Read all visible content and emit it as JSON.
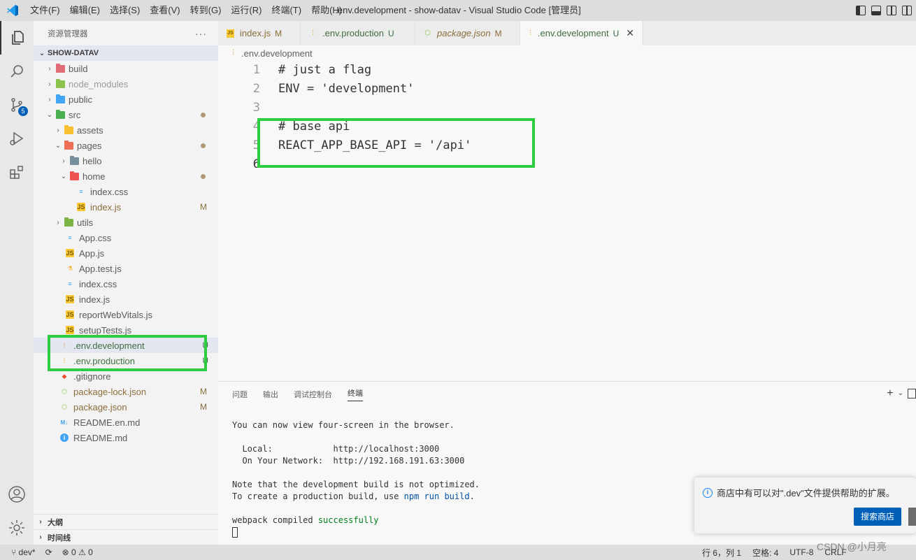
{
  "titlebar": {
    "menu": [
      "文件(F)",
      "编辑(E)",
      "选择(S)",
      "查看(V)",
      "转到(G)",
      "运行(R)",
      "终端(T)",
      "帮助(H)"
    ],
    "window_title": ".env.development - show-datav - Visual Studio Code [管理员]"
  },
  "activity": {
    "scm_badge": "5"
  },
  "sidebar": {
    "title": "资源管理器",
    "more": "···",
    "project": "SHOW-DATAV",
    "tree": {
      "build": "build",
      "node_modules": "node_modules",
      "public": "public",
      "src": "src",
      "assets": "assets",
      "pages": "pages",
      "hello": "hello",
      "home": "home",
      "index_css": "index.css",
      "index_js": "index.js",
      "index_js_status": "M",
      "utils": "utils",
      "app_css": "App.css",
      "app_js": "App.js",
      "app_test_js": "App.test.js",
      "src_index_css": "index.css",
      "src_index_js": "index.js",
      "report": "reportWebVitals.js",
      "setup": "setupTests.js",
      "env_dev": ".env.development",
      "env_dev_status": "U",
      "env_prod": ".env.production",
      "env_prod_status": "U",
      "gitignore": ".gitignore",
      "pkg_lock": "package-lock.json",
      "pkg_lock_status": "M",
      "pkg": "package.json",
      "pkg_status": "M",
      "readme_en": "README.en.md",
      "readme": "README.md"
    },
    "outline": "大纲",
    "timeline": "时间线"
  },
  "tabs": [
    {
      "name": "index.js",
      "status": "M"
    },
    {
      "name": ".env.production",
      "status": "U"
    },
    {
      "name": "package.json",
      "status": "M"
    },
    {
      "name": ".env.development",
      "status": "U",
      "close": "✕"
    }
  ],
  "breadcrumb": ".env.development",
  "editor": {
    "lines": [
      {
        "num": "1",
        "text": "# just a flag"
      },
      {
        "num": "2",
        "text": "ENV = 'development'"
      },
      {
        "num": "3",
        "text": ""
      },
      {
        "num": "4",
        "text": "# base api"
      },
      {
        "num": "5",
        "text": "REACT_APP_BASE_API = '/api'"
      },
      {
        "num": "6",
        "text": ""
      }
    ]
  },
  "panel": {
    "tabs": [
      "问题",
      "输出",
      "调试控制台",
      "终端"
    ],
    "terminal": {
      "l1": "You can now view four-screen in the browser.",
      "local_label": "  Local:            ",
      "local_url": "http://localhost:3000",
      "net_label": "  On Your Network:  ",
      "net_url": "http://192.168.191.63:3000",
      "l4": "Note that the development build is not optimized.",
      "l5a": "To create a production build, use ",
      "l5b": "npm run build",
      "l5c": ".",
      "l6a": "webpack compiled ",
      "l6b": "successfully"
    }
  },
  "notification": {
    "message": "商店中有可以对\".dev\"文件提供帮助的扩展。",
    "button": "搜索商店"
  },
  "statusbar": {
    "branch": "dev*",
    "problems": "⊗ 0 ⚠ 0",
    "position": "行 6，列 1",
    "spaces": "空格: 4",
    "encoding": "UTF-8",
    "eol": "CRLF"
  },
  "watermark": "CSDN @小月亮",
  "colors": {
    "highlight": "#2ecc40",
    "accent": "#005fb8",
    "modified": "#8a6d3b",
    "untracked": "#3f6f3f"
  }
}
